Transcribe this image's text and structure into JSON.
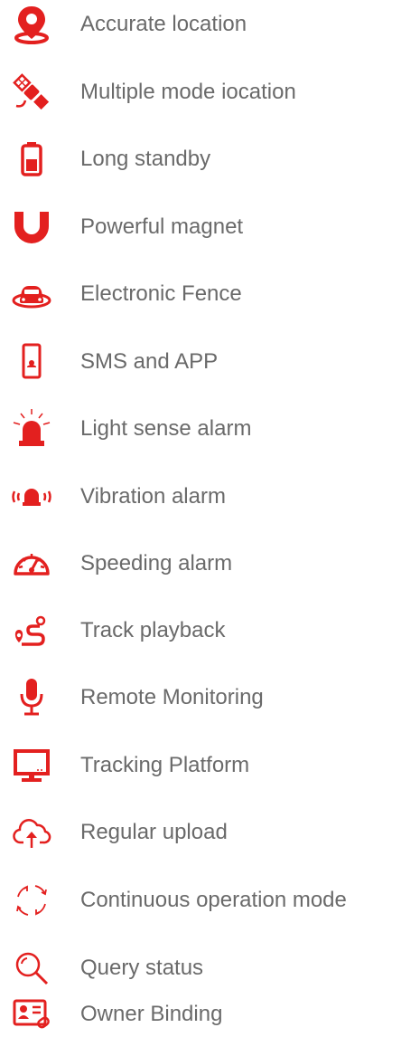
{
  "colors": {
    "accent": "#e3201f",
    "text": "#6a6a6a",
    "background": "#ffffff"
  },
  "features": [
    {
      "label": "Accurate location",
      "icon": "location-pin-icon"
    },
    {
      "label": "Multiple mode iocation",
      "icon": "satellite-icon"
    },
    {
      "label": "Long standby",
      "icon": "battery-icon"
    },
    {
      "label": "Powerful magnet",
      "icon": "magnet-icon"
    },
    {
      "label": "Electronic Fence",
      "icon": "car-fence-icon"
    },
    {
      "label": "SMS and APP",
      "icon": "smartphone-icon"
    },
    {
      "label": "Light sense alarm",
      "icon": "siren-light-icon"
    },
    {
      "label": "Vibration alarm",
      "icon": "vibration-alarm-icon"
    },
    {
      "label": "Speeding alarm",
      "icon": "speedometer-icon"
    },
    {
      "label": "Track playback",
      "icon": "track-route-icon"
    },
    {
      "label": "Remote Monitoring",
      "icon": "microphone-icon"
    },
    {
      "label": "Tracking Platform",
      "icon": "monitor-icon"
    },
    {
      "label": "Regular upload",
      "icon": "cloud-upload-icon"
    },
    {
      "label": "Continuous operation mode",
      "icon": "cycle-arrows-icon"
    },
    {
      "label": "Query status",
      "icon": "magnifier-icon"
    },
    {
      "label": "Owner Binding",
      "icon": "id-card-link-icon"
    }
  ]
}
